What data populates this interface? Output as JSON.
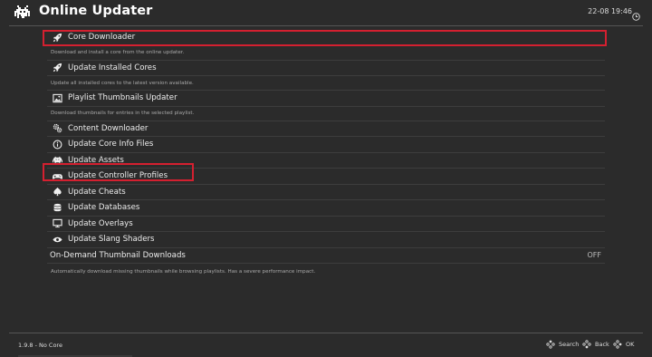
{
  "header": {
    "title": "Online Updater",
    "clock": "22-08 19:46"
  },
  "menu": {
    "items": [
      {
        "label": "Core Downloader",
        "icon": "rocket-icon",
        "description": "Download and install a core from the online updater."
      },
      {
        "label": "Update Installed Cores",
        "icon": "rocket-icon",
        "description": "Update all installed cores to the latest version available."
      },
      {
        "label": "Playlist Thumbnails Updater",
        "icon": "image-icon",
        "description": "Download thumbnails for entries in the selected playlist."
      },
      {
        "label": "Content Downloader",
        "icon": "gears-icon"
      },
      {
        "label": "Update Core Info Files",
        "icon": "info-icon"
      },
      {
        "label": "Update Assets",
        "icon": "invader-icon"
      },
      {
        "label": "Update Controller Profiles",
        "icon": "gamepad-icon"
      },
      {
        "label": "Update Cheats",
        "icon": "spade-icon"
      },
      {
        "label": "Update Databases",
        "icon": "database-icon"
      },
      {
        "label": "Update Overlays",
        "icon": "monitor-icon"
      },
      {
        "label": "Update Slang Shaders",
        "icon": "eye-icon"
      }
    ],
    "on_demand": {
      "label": "On-Demand Thumbnail Downloads",
      "value": "OFF",
      "description": "Automatically download missing thumbnails while browsing playlists. Has a severe performance impact."
    }
  },
  "footer": {
    "version": "1.9.8 - No Core",
    "search_label": "Search",
    "back_label": "Back",
    "ok_label": "OK"
  },
  "colors": {
    "highlight": "#d42030",
    "background": "#2b2b2b"
  }
}
